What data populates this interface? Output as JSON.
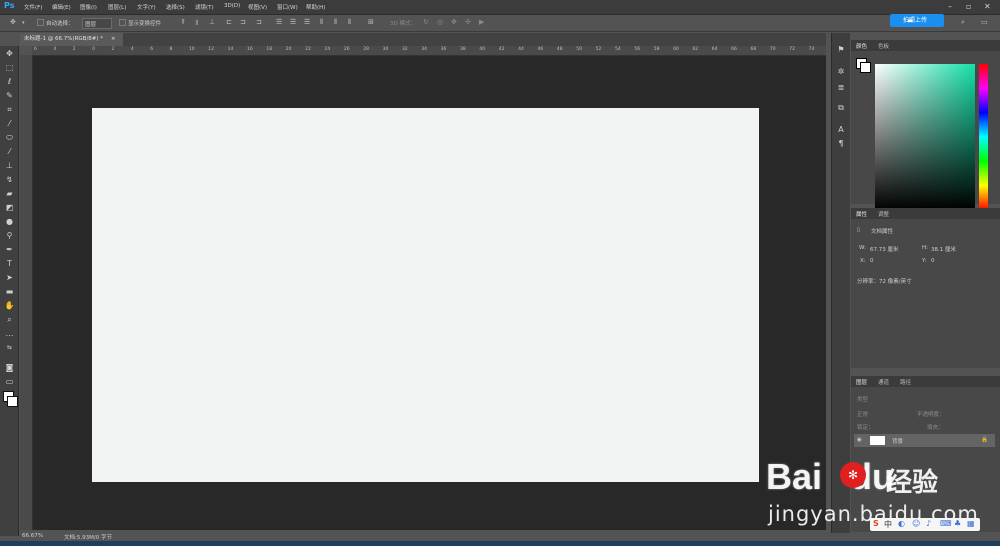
{
  "app": {
    "logo": "Ps"
  },
  "menu": [
    "文件(F)",
    "编辑(E)",
    "图像(I)",
    "图层(L)",
    "文字(Y)",
    "选择(S)",
    "滤镜(T)",
    "3D(D)",
    "视图(V)",
    "窗口(W)",
    "帮助(H)"
  ],
  "options": {
    "auto_select_label": "自动选择：",
    "auto_select_value": "图层",
    "show_transform_label": "显示变换控件",
    "mode_3d_label": "3D 模式："
  },
  "cloud_button": "拍照上传",
  "doc_tab": {
    "title": "未标题-1 @ 66.7%(RGB/8#) *",
    "close": "×"
  },
  "ruler_marks": [
    "6",
    "4",
    "2",
    "0",
    "2",
    "4",
    "6",
    "8",
    "10",
    "12",
    "14",
    "16",
    "18",
    "20",
    "22",
    "24",
    "26",
    "28",
    "30",
    "32",
    "34",
    "36",
    "38",
    "40",
    "42",
    "44",
    "46",
    "48",
    "50",
    "52",
    "54",
    "56",
    "58",
    "60",
    "62",
    "64",
    "66",
    "68",
    "70",
    "72",
    "74"
  ],
  "color_panel": {
    "tabs": [
      "颜色",
      "色板"
    ]
  },
  "properties_panel": {
    "tabs": [
      "属性",
      "调整"
    ],
    "heading": "文档属性",
    "w_label": "W:",
    "w_value": "67.73 厘米",
    "h_label": "H:",
    "h_value": "38.1 厘米",
    "x_label": "X:",
    "x_value": "0",
    "y_label": "Y:",
    "y_value": "0",
    "resolution": "分辨率：72 像素/英寸"
  },
  "layers_panel": {
    "tabs": [
      "图层",
      "通道",
      "路径"
    ],
    "kind": "类型",
    "blend_mode": "正常",
    "opacity_label": "不透明度：",
    "lock_label": "锁定：",
    "fill_label": "填充：",
    "layer_name": "背景"
  },
  "status": {
    "zoom": "66.67%",
    "doc_info": "文档:5.93M/0 字节"
  },
  "watermark": {
    "brand_a": "Bai",
    "brand_b": "du",
    "brand_cn": "经验",
    "url": "jingyan.baidu.com"
  },
  "ime": {
    "logo": "S",
    "lang": "中"
  }
}
